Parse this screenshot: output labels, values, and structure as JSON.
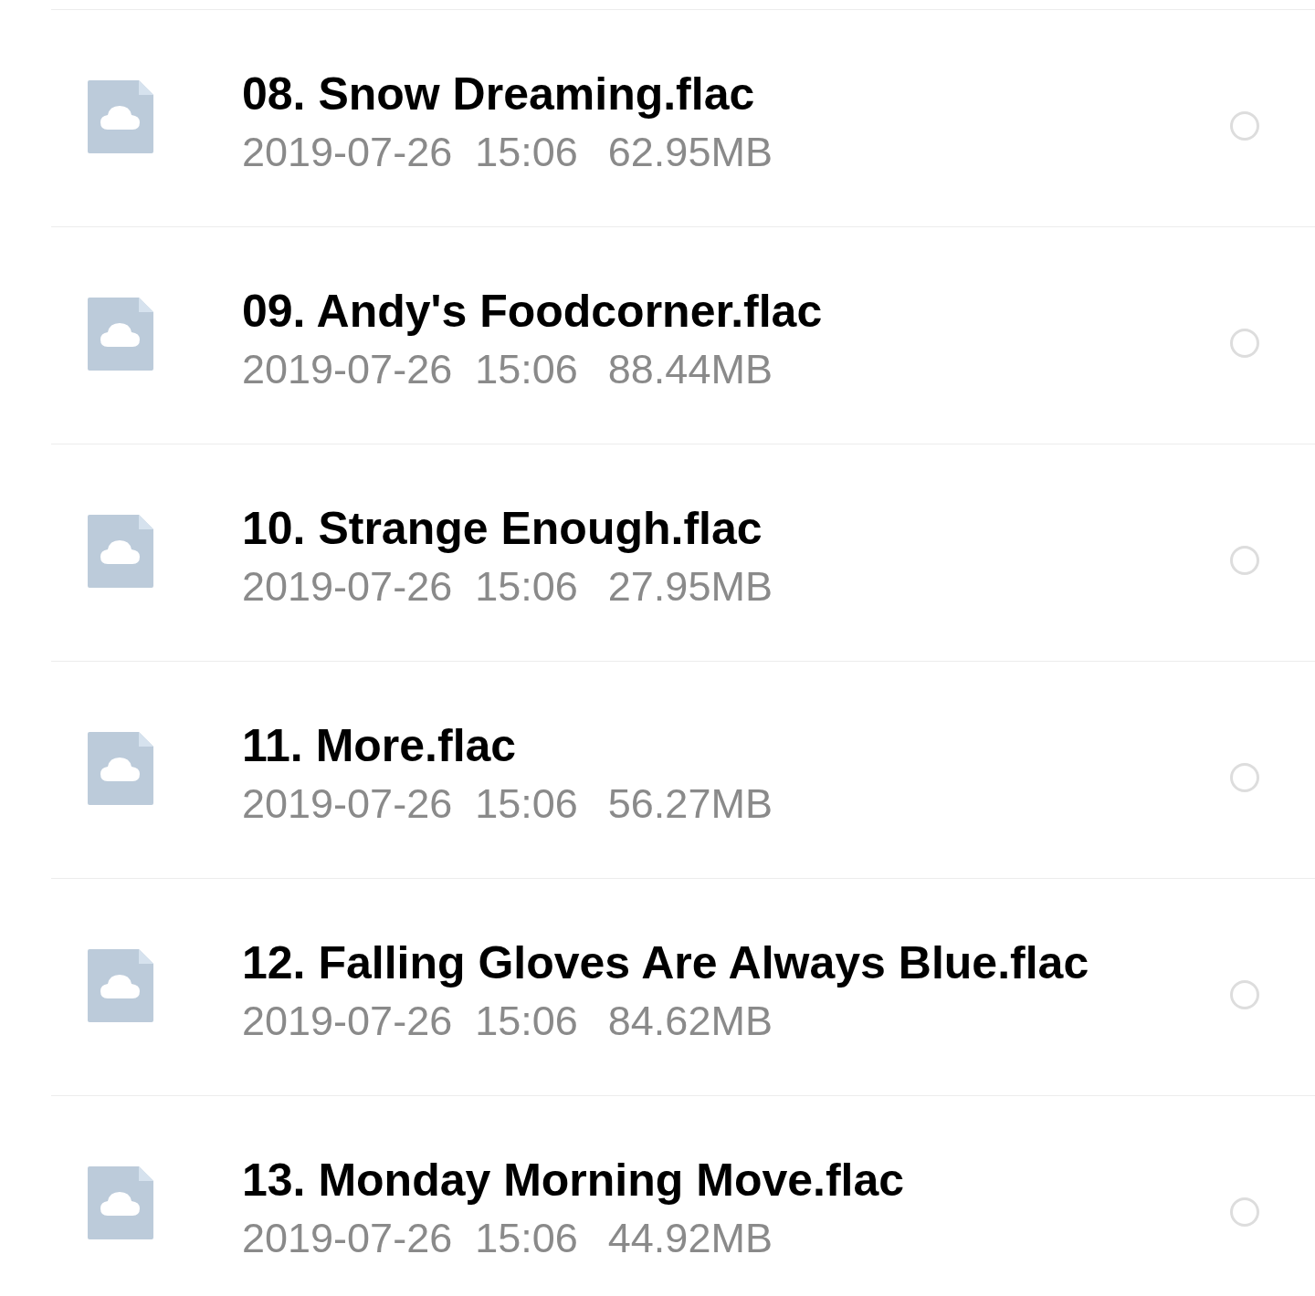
{
  "files": [
    {
      "name": "08. Snow Dreaming.flac",
      "date": "2019-07-26",
      "time": "15:06",
      "size": "62.95MB",
      "selected": false
    },
    {
      "name": "09. Andy's Foodcorner.flac",
      "date": "2019-07-26",
      "time": "15:06",
      "size": "88.44MB",
      "selected": false
    },
    {
      "name": "10. Strange Enough.flac",
      "date": "2019-07-26",
      "time": "15:06",
      "size": "27.95MB",
      "selected": false
    },
    {
      "name": "11. More.flac",
      "date": "2019-07-26",
      "time": "15:06",
      "size": "56.27MB",
      "selected": false
    },
    {
      "name": "12. Falling Gloves Are Always Blue.flac",
      "date": "2019-07-26",
      "time": "15:06",
      "size": "84.62MB",
      "selected": false
    },
    {
      "name": "13. Monday Morning Move.flac",
      "date": "2019-07-26",
      "time": "15:06",
      "size": "44.92MB",
      "selected": false
    }
  ]
}
